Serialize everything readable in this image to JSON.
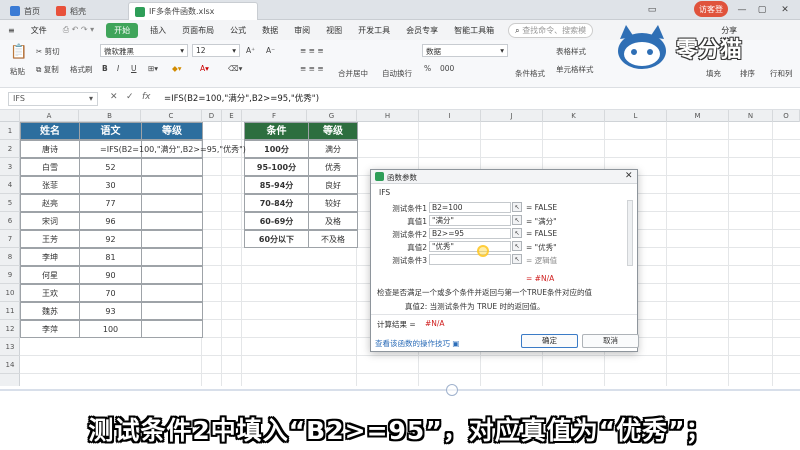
{
  "tabs": [
    "首页",
    "稻壳",
    "IF多条件函数.xlsx"
  ],
  "titlebar": {
    "visitor_label": "访客登"
  },
  "menu": {
    "file": "文件",
    "items": [
      "开始",
      "插入",
      "页面布局",
      "公式",
      "数据",
      "审阅",
      "视图",
      "开发工具",
      "会员专享",
      "智能工具箱"
    ],
    "search_placeholder": "查找命令、搜索模",
    "share": "分享"
  },
  "ribbon": {
    "paste": "粘贴",
    "cut": "剪切",
    "copy": "复制",
    "format_painter": "格式刷",
    "font_name": "微软雅黑",
    "font_size": "12",
    "bold": "B",
    "italic": "I",
    "underline": "U",
    "font_grow": "A⁺",
    "font_shrink": "A⁻",
    "merge": "合并居中",
    "wrap": "自动换行",
    "number_format": "数据",
    "conditional": "条件格式",
    "table_style": "表格样式",
    "cell_style": "单元格样式",
    "fill": "填充",
    "sort": "排序",
    "row_col": "行和列",
    "percent": "%",
    "thousands": "000"
  },
  "logo": {
    "text": "零分猫"
  },
  "formula_bar": {
    "name_box": "IFS",
    "formula": "=IFS(B2=100,\"满分\",B2>=95,\"优秀\")"
  },
  "columns": [
    "A",
    "B",
    "C",
    "D",
    "E",
    "F",
    "G",
    "H",
    "I",
    "J",
    "K",
    "L",
    "M",
    "N",
    "O"
  ],
  "rows": [
    "1",
    "2",
    "3",
    "4",
    "5",
    "6",
    "7",
    "8",
    "9",
    "10",
    "11",
    "12",
    "13",
    "14"
  ],
  "table1": {
    "headers": [
      "姓名",
      "语文",
      "等级"
    ],
    "rows": [
      [
        "唐诗",
        "=IFS(B2=100,\"满分\",B2>=95,\"优秀\")",
        ""
      ],
      [
        "白雪",
        "52",
        ""
      ],
      [
        "张菲",
        "30",
        ""
      ],
      [
        "赵亮",
        "77",
        ""
      ],
      [
        "宋词",
        "96",
        ""
      ],
      [
        "王芳",
        "92",
        ""
      ],
      [
        "李坤",
        "81",
        ""
      ],
      [
        "何星",
        "90",
        ""
      ],
      [
        "王欢",
        "70",
        ""
      ],
      [
        "魏苏",
        "93",
        ""
      ],
      [
        "李萍",
        "100",
        ""
      ]
    ]
  },
  "table2": {
    "headers": [
      "条件",
      "等级"
    ],
    "rows": [
      [
        "100分",
        "满分"
      ],
      [
        "95-100分",
        "优秀"
      ],
      [
        "85-94分",
        "良好"
      ],
      [
        "70-84分",
        "较好"
      ],
      [
        "60-69分",
        "及格"
      ],
      [
        "60分以下",
        "不及格"
      ]
    ]
  },
  "dialog": {
    "title": "函数参数",
    "func": "IFS",
    "params": [
      {
        "label": "测试条件1",
        "value": "B2=100",
        "result": "= FALSE"
      },
      {
        "label": "真值1",
        "value": "\"满分\"",
        "result": "= \"满分\""
      },
      {
        "label": "测试条件2",
        "value": "B2>=95",
        "result": "= FALSE"
      },
      {
        "label": "真值2",
        "value": "\"优秀\"",
        "result": "= \"优秀\""
      },
      {
        "label": "测试条件3",
        "value": "",
        "result": "= 逻辑值"
      }
    ],
    "overall_result": "= #N/A",
    "description": "检查是否满足一个或多个条件并返回与第一个TRUE条件对应的值",
    "param_help": "真值2:  当测试条件为 TRUE 时的返回值。",
    "calc_label": "计算结果 =",
    "calc_value": "#N/A",
    "help_link": "查看该函数的操作技巧",
    "ok": "确定",
    "cancel": "取消"
  },
  "subtitle": "测试条件2中填入“B2>=95”，对应真值为“优秀”；"
}
